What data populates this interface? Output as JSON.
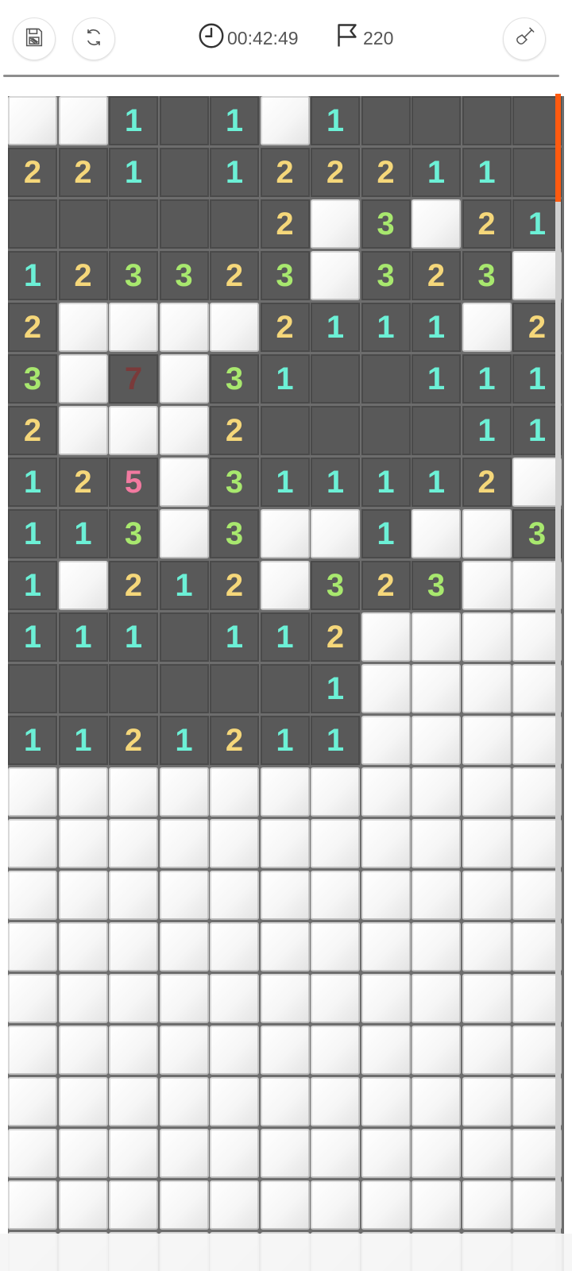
{
  "toolbar": {
    "timer": "00:42:49",
    "flags": "220",
    "icons": {
      "save": "floppy-disk-icon",
      "restart": "refresh-icon",
      "clock": "clock-icon",
      "flag": "flag-icon",
      "dig": "shovel-icon"
    }
  },
  "board": {
    "columns": 11,
    "legend": {
      "o": "opened empty cell",
      "c": "closed cell",
      "digit": "opened cell showing adjacent mine count"
    },
    "rows": [
      [
        "c",
        "c",
        "1",
        "o",
        "1",
        "c",
        "1",
        "o",
        "o",
        "o",
        "o"
      ],
      [
        "2",
        "2",
        "1",
        "o",
        "1",
        "2",
        "2",
        "2",
        "1",
        "1",
        "o"
      ],
      [
        "o",
        "o",
        "o",
        "o",
        "o",
        "2",
        "c",
        "3",
        "c",
        "2",
        "1"
      ],
      [
        "1",
        "2",
        "3",
        "3",
        "2",
        "3",
        "c",
        "3",
        "2",
        "3",
        "c"
      ],
      [
        "2",
        "c",
        "c",
        "c",
        "c",
        "2",
        "1",
        "1",
        "1",
        "c",
        "2"
      ],
      [
        "3",
        "c",
        "7",
        "c",
        "3",
        "1",
        "o",
        "o",
        "1",
        "1",
        "1"
      ],
      [
        "2",
        "c",
        "c",
        "c",
        "2",
        "o",
        "o",
        "o",
        "o",
        "1",
        "1"
      ],
      [
        "1",
        "2",
        "5",
        "c",
        "3",
        "1",
        "1",
        "1",
        "1",
        "2",
        "c"
      ],
      [
        "1",
        "1",
        "3",
        "c",
        "3",
        "c",
        "c",
        "1",
        "c",
        "c",
        "3"
      ],
      [
        "1",
        "c",
        "2",
        "1",
        "2",
        "c",
        "3",
        "2",
        "3",
        "c",
        "c"
      ],
      [
        "1",
        "1",
        "1",
        "o",
        "1",
        "1",
        "2",
        "c",
        "c",
        "c",
        "c"
      ],
      [
        "o",
        "o",
        "o",
        "o",
        "o",
        "o",
        "1",
        "c",
        "c",
        "c",
        "c"
      ],
      [
        "1",
        "1",
        "2",
        "1",
        "2",
        "1",
        "1",
        "c",
        "c",
        "c",
        "c"
      ],
      [
        "c",
        "c",
        "c",
        "c",
        "c",
        "c",
        "c",
        "c",
        "c",
        "c",
        "c"
      ],
      [
        "c",
        "c",
        "c",
        "c",
        "c",
        "c",
        "c",
        "c",
        "c",
        "c",
        "c"
      ],
      [
        "c",
        "c",
        "c",
        "c",
        "c",
        "c",
        "c",
        "c",
        "c",
        "c",
        "c"
      ],
      [
        "c",
        "c",
        "c",
        "c",
        "c",
        "c",
        "c",
        "c",
        "c",
        "c",
        "c"
      ],
      [
        "c",
        "c",
        "c",
        "c",
        "c",
        "c",
        "c",
        "c",
        "c",
        "c",
        "c"
      ],
      [
        "c",
        "c",
        "c",
        "c",
        "c",
        "c",
        "c",
        "c",
        "c",
        "c",
        "c"
      ],
      [
        "c",
        "c",
        "c",
        "c",
        "c",
        "c",
        "c",
        "c",
        "c",
        "c",
        "c"
      ],
      [
        "c",
        "c",
        "c",
        "c",
        "c",
        "c",
        "c",
        "c",
        "c",
        "c",
        "c"
      ],
      [
        "c",
        "c",
        "c",
        "c",
        "c",
        "c",
        "c",
        "c",
        "c",
        "c",
        "c"
      ],
      [
        "c",
        "c",
        "c",
        "c",
        "c",
        "c",
        "c",
        "c",
        "c",
        "c",
        "c"
      ]
    ]
  },
  "colors": {
    "1": "#6cf0d6",
    "2": "#f5d77a",
    "3": "#a8e86e",
    "5": "#f27aa0",
    "7": "#7a3a3a",
    "scroll_thumb": "#ff5a0f"
  }
}
